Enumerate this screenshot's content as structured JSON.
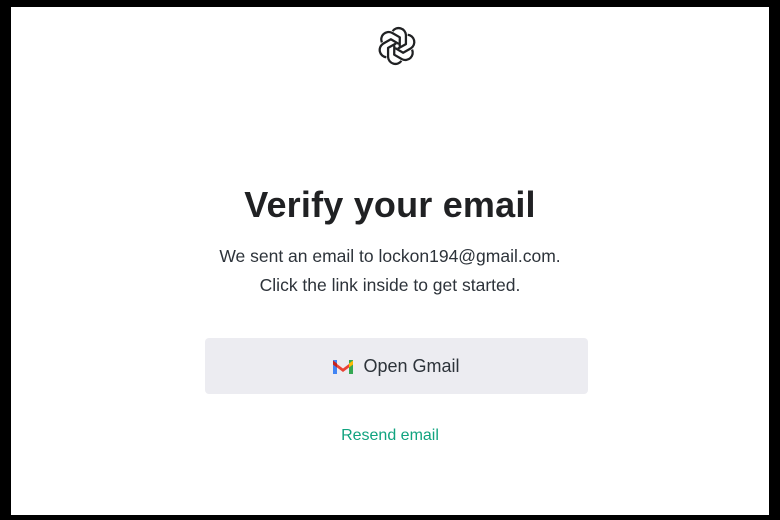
{
  "header": {
    "logo_icon": "openai-logo-icon"
  },
  "main": {
    "title": "Verify your email",
    "description_line1": "We sent an email to lockon194@gmail.com.",
    "description_line2": "Click the link inside to get started.",
    "open_gmail": {
      "label": "Open Gmail",
      "icon": "gmail-icon"
    },
    "resend_label": "Resend email"
  },
  "colors": {
    "background": "#ffffff",
    "frame": "#000000",
    "button_bg": "#ececf1",
    "link": "#10a37f",
    "text": "#202123"
  }
}
